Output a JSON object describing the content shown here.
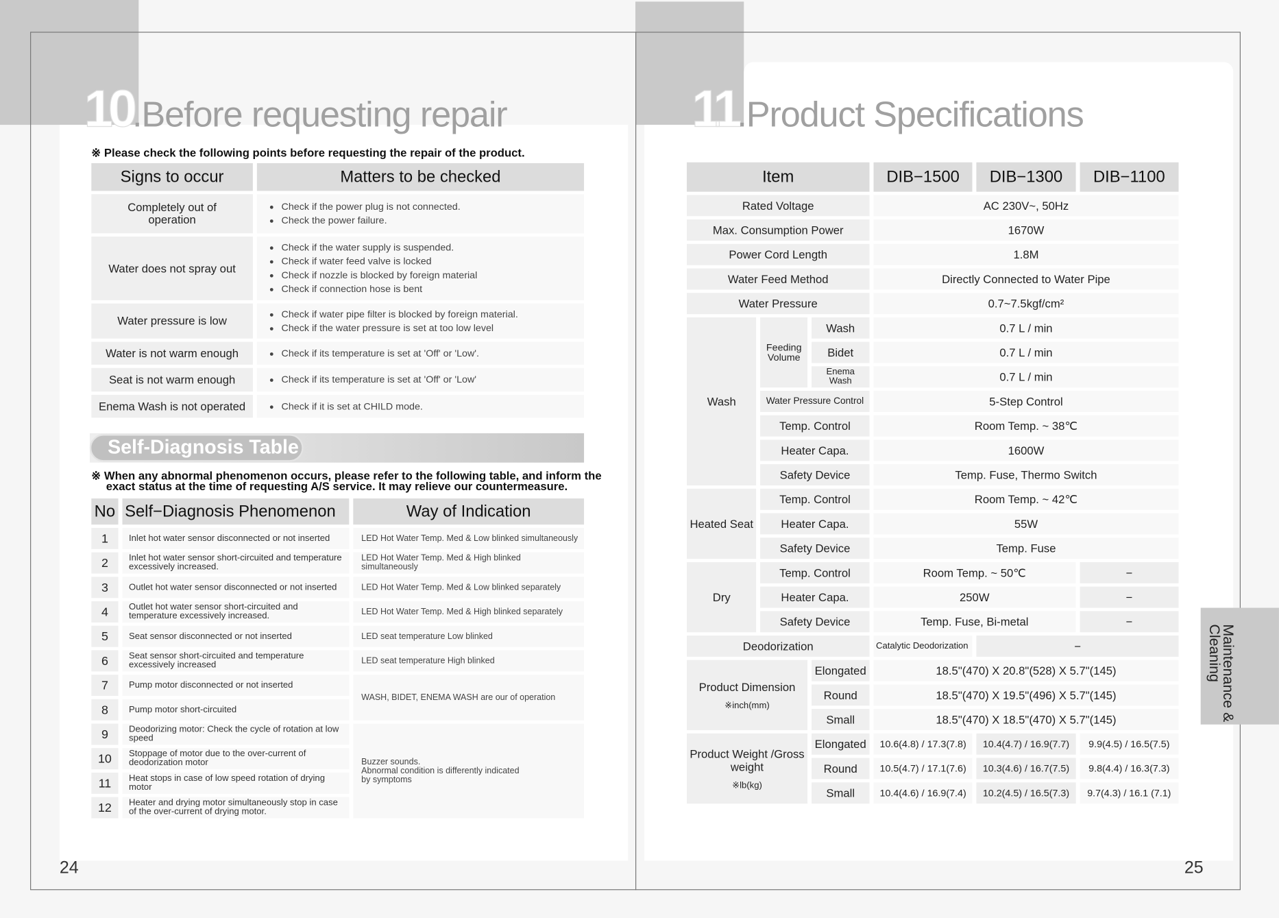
{
  "left_page": {
    "section_number": "10",
    "title": ".Before requesting repair",
    "note": "※ Please check the following points before requesting the repair of the product.",
    "repair_table": {
      "headers": [
        "Signs to occur",
        "Matters to be checked"
      ],
      "rows": [
        {
          "sign": "Completely out of operation",
          "checks": [
            "Check if the power plug is not connected.",
            "Check the power failure."
          ]
        },
        {
          "sign": "Water does not spray out",
          "checks": [
            "Check if the water supply is suspended.",
            "Check if water feed valve is locked",
            "Check if nozzle is blocked by foreign material",
            "Check if connection hose is bent"
          ]
        },
        {
          "sign": "Water pressure is low",
          "checks": [
            "Check if water pipe filter is blocked by foreign material.",
            "Check if the water pressure is set at too low level"
          ]
        },
        {
          "sign": "Water is not warm enough",
          "checks": [
            "Check if its temperature is set at 'Off' or 'Low'."
          ]
        },
        {
          "sign": "Seat is not warm enough",
          "checks": [
            "Check if its temperature is set at 'Off' or 'Low'"
          ]
        },
        {
          "sign": "Enema Wash is not operated",
          "checks": [
            "Check if it is set at CHILD mode."
          ]
        }
      ]
    },
    "self_diag_title": "Self-Diagnosis Table",
    "self_diag_note": "※ When any abnormal phenomenon occurs, please refer to the following table, and inform the exact status at the time of requesting A/S service. It may relieve our countermeasure.",
    "diag_table": {
      "headers": [
        "No",
        "Self−Diagnosis Phenomenon",
        "Way of Indication"
      ],
      "rows": [
        {
          "no": "1",
          "phenomenon": "Inlet hot water sensor disconnected or not inserted",
          "indication": "LED Hot Water Temp. Med & Low blinked simultaneously"
        },
        {
          "no": "2",
          "phenomenon": "Inlet hot water sensor short-circuited and temperature excessively increased.",
          "indication": "LED Hot Water Temp. Med & High blinked simultaneously"
        },
        {
          "no": "3",
          "phenomenon": "Outlet hot water sensor disconnected or not inserted",
          "indication": "LED Hot Water Temp. Med & Low blinked separately"
        },
        {
          "no": "4",
          "phenomenon": "Outlet hot water sensor short-circuited and temperature excessively increased.",
          "indication": "LED Hot Water Temp. Med & High blinked separately"
        },
        {
          "no": "5",
          "phenomenon": "Seat sensor disconnected or not inserted",
          "indication": "LED seat temperature Low blinked"
        },
        {
          "no": "6",
          "phenomenon": "Seat sensor short-circuited and temperature excessively increased",
          "indication": "LED seat temperature High blinked"
        },
        {
          "no": "7",
          "phenomenon": "Pump motor disconnected or not inserted",
          "indication": "WASH, BIDET, ENEMA WASH are our of operation"
        },
        {
          "no": "8",
          "phenomenon": "Pump motor short-circuited"
        },
        {
          "no": "9",
          "phenomenon": "Deodorizing motor: Check the cycle of rotation at low speed",
          "indication": "Buzzer sounds.\nAbnormal condition is differently indicated\nby symptoms"
        },
        {
          "no": "10",
          "phenomenon": "Stoppage of motor due to the over-current of deodorization motor"
        },
        {
          "no": "11",
          "phenomenon": "Heat stops in case of low speed rotation of drying motor"
        },
        {
          "no": "12",
          "phenomenon": "Heater and drying motor simultaneously stop in case of the over-current of drying motor."
        }
      ]
    },
    "page_number": "24"
  },
  "right_page": {
    "section_number": "11",
    "title": ".Product Specifications",
    "spec": {
      "header": {
        "item": "Item",
        "models": [
          "DIB−1500",
          "DIB−1300",
          "DIB−1100"
        ]
      },
      "rated_voltage": [
        "Rated Voltage",
        "AC 230V~, 50Hz"
      ],
      "max_power": [
        "Max. Consumption Power",
        "1670W"
      ],
      "cord": [
        "Power Cord Length",
        "1.8M"
      ],
      "feed": [
        "Water Feed Method",
        "Directly Connected to Water Pipe"
      ],
      "pressure": [
        "Water Pressure",
        "0.7~7.5kgf/cm²"
      ],
      "wash": {
        "label": "Wash",
        "feeding": "Feeding Volume",
        "wash": [
          "Wash",
          "0.7 L / min"
        ],
        "bidet": [
          "Bidet",
          "0.7 L / min"
        ],
        "enema": [
          "Enema Wash",
          "0.7 L / min"
        ],
        "wpc": [
          "Water Pressure Control",
          "5-Step Control"
        ],
        "temp": [
          "Temp. Control",
          "Room Temp. ~ 38℃"
        ],
        "heater": [
          "Heater Capa.",
          "1600W"
        ],
        "safety": [
          "Safety Device",
          "Temp. Fuse, Thermo Switch"
        ]
      },
      "seat": {
        "label": "Heated Seat",
        "temp": [
          "Temp. Control",
          "Room Temp. ~ 42℃"
        ],
        "heater": [
          "Heater Capa.",
          "55W"
        ],
        "safety": [
          "Safety Device",
          "Temp. Fuse"
        ]
      },
      "dry": {
        "label": "Dry",
        "temp": [
          "Temp. Control",
          "Room Temp. ~ 50℃",
          "−"
        ],
        "heater": [
          "Heater Capa.",
          "250W",
          "−"
        ],
        "safety": [
          "Safety Device",
          "Temp. Fuse, Bi-metal",
          "−"
        ]
      },
      "deodor": [
        "Deodorization",
        "Catalytic Deodorization",
        "−"
      ],
      "dimension": {
        "label": "Product Dimension",
        "unit": "※inch(mm)",
        "rows": [
          [
            "Elongated",
            "18.5\"(470) X 20.8\"(528) X 5.7\"(145)"
          ],
          [
            "Round",
            "18.5\"(470) X 19.5\"(496) X 5.7\"(145)"
          ],
          [
            "Small",
            "18.5\"(470) X 18.5\"(470) X 5.7\"(145)"
          ]
        ]
      },
      "weight": {
        "label": "Product Weight /Gross weight",
        "unit": "※lb(kg)",
        "rows": [
          [
            "Elongated",
            "10.6(4.8) / 17.3(7.8)",
            "10.4(4.7) / 16.9(7.7)",
            "9.9(4.5) / 16.5(7.5)"
          ],
          [
            "Round",
            "10.5(4.7) / 17.1(7.6)",
            "10.3(4.6) / 16.7(7.5)",
            "9.8(4.4) / 16.3(7.3)"
          ],
          [
            "Small",
            "10.4(4.6) / 16.9(7.4)",
            "10.2(4.5) / 16.5(7.3)",
            "9.7(4.3) / 16.1 (7.1)"
          ]
        ]
      }
    },
    "side_tab": "Maintenance & Cleaning",
    "page_number": "25"
  }
}
